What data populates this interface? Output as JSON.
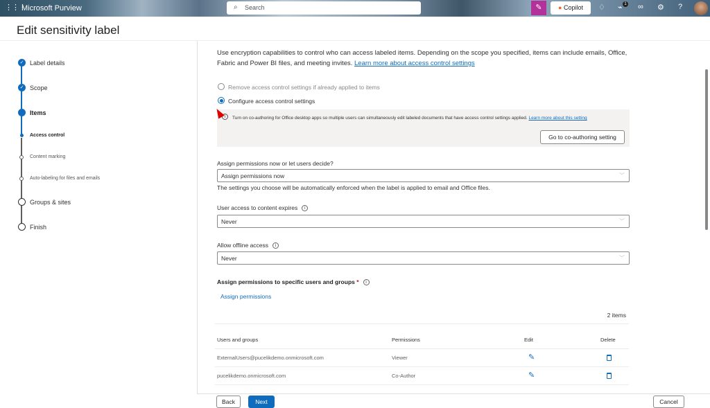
{
  "topbar": {
    "app_name": "Microsoft Purview",
    "search_placeholder": "Search",
    "copilot_label": "Copilot",
    "notification_count": "1"
  },
  "page": {
    "title": "Edit sensitivity label"
  },
  "nav": {
    "steps": [
      {
        "label": "Label details",
        "state": "done"
      },
      {
        "label": "Scope",
        "state": "done"
      },
      {
        "label": "Items",
        "state": "current"
      },
      {
        "label": "Access control",
        "state": "current-sub"
      },
      {
        "label": "Content marking",
        "state": "pending-sub"
      },
      {
        "label": "Auto-labeling for files and emails",
        "state": "pending-sub"
      },
      {
        "label": "Groups & sites",
        "state": "pending"
      },
      {
        "label": "Finish",
        "state": "pending"
      }
    ]
  },
  "content": {
    "intro": "Use encryption capabilities to control who can access labeled items. Depending on the scope you specified, items can include emails, Office, Fabric and Power BI files, and meeting invites.",
    "intro_link": "Learn more about access control settings",
    "radio_remove": "Remove access control settings if already applied to items",
    "radio_configure": "Configure access control settings",
    "info_text": "Turn on co-authoring for Office desktop apps so multiple users can simultaneously edit labeled documents that have access control settings applied.",
    "info_link": "Learn more about this setting",
    "coauthoring_button": "Go to co-authoring setting",
    "assign_label": "Assign permissions now or let users decide?",
    "assign_value": "Assign permissions now",
    "assign_help": "The settings you choose will be automatically enforced when the label is applied to email and Office files.",
    "expires_label": "User access to content expires",
    "expires_value": "Never",
    "offline_label": "Allow offline access",
    "offline_value": "Never",
    "specific_heading": "Assign permissions to specific users and groups",
    "required_mark": "*",
    "assign_link": "Assign permissions",
    "item_count": "2 items",
    "table": {
      "headers": [
        "Users and groups",
        "Permissions",
        "Edit",
        "Delete"
      ],
      "rows": [
        {
          "user": "ExternalUsers@pucelikdemo.onmicrosoft.com",
          "permission": "Viewer"
        },
        {
          "user": "pucelikdemo.onmicrosoft.com",
          "permission": "Co-Author"
        }
      ]
    }
  },
  "footer": {
    "back": "Back",
    "next": "Next",
    "cancel": "Cancel"
  }
}
